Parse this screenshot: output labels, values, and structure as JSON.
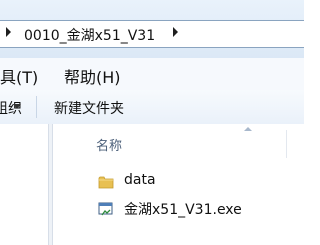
{
  "address_bar": {
    "path_segment": "0010_金湖x51_V31"
  },
  "menu": {
    "tools": "工具(T)",
    "help": "帮助(H)"
  },
  "toolbar": {
    "organize_partial": "组织",
    "new_folder": "新建文件夹"
  },
  "file_list": {
    "column_name": "名称",
    "items": [
      {
        "name": "data",
        "icon": "folder-icon"
      },
      {
        "name": "金湖x51_V31.exe",
        "icon": "exe-file-icon"
      }
    ]
  },
  "colors": {
    "address_bg": "#dbe8f6",
    "menu_bg": "#f6f9fd",
    "toolbar_bg": "#eaf1fa",
    "folder_yellow": "#e8c052",
    "header_text": "#4c607a"
  }
}
